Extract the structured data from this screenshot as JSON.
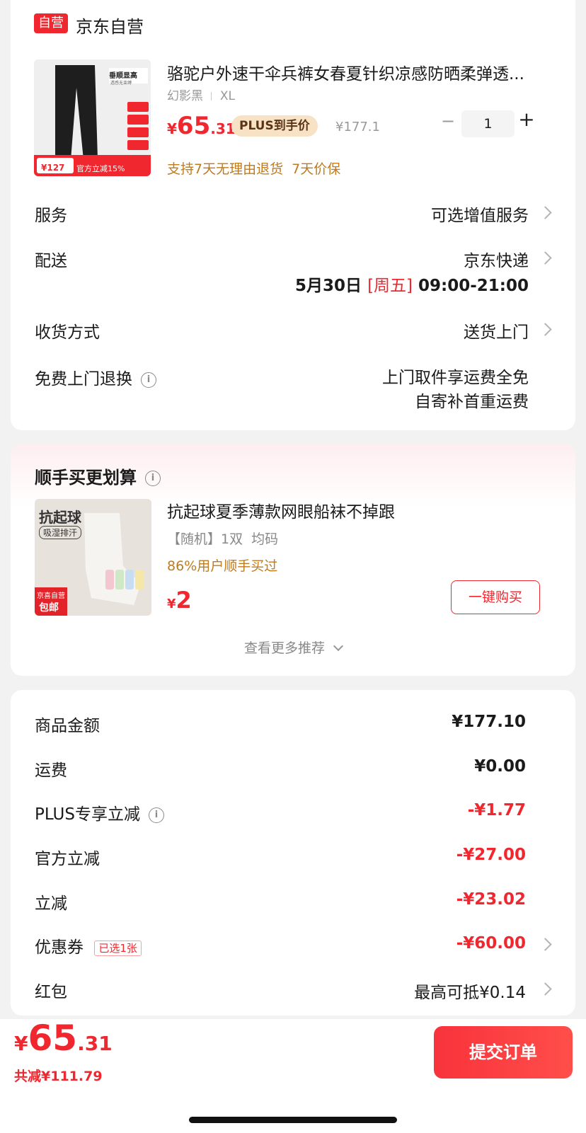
{
  "store": {
    "badge": "自营",
    "name": "京东自营"
  },
  "product": {
    "title": "骆驼户外速干伞兵裤女春夏针织凉感防晒柔弹透...",
    "spec_color": "幻影黑",
    "spec_size": "XL",
    "price_symbol": "¥",
    "price_int": "65",
    "price_dec": ".31",
    "plus_tag": "PLUS到手价",
    "orig_price": "¥177.1",
    "quantity": "1",
    "minus": "−",
    "plus": "+",
    "service_tags": "支持7天无理由退货  7天价保",
    "thumb_heading": "垂顺显高",
    "thumb_subheading": "透感无束缚",
    "thumb_price_label": "¥127",
    "thumb_promo": "官方立减15%"
  },
  "rows": {
    "service_label": "服务",
    "service_value": "可选增值服务",
    "delivery_label": "配送",
    "delivery_value": "京东快递",
    "delivery_date": "5月30日",
    "delivery_weekday": "[周五]",
    "delivery_time": "09:00-21:00",
    "receive_label": "收货方式",
    "receive_value": "送货上门",
    "return_label": "免费上门退换",
    "return_value_1": "上门取件享运费全免",
    "return_value_2": "自寄补首重运费"
  },
  "recommend": {
    "title": "顺手买更划算",
    "item_title": "抗起球夏季薄款网眼船袜不掉跟",
    "item_spec": "【随机】1双  均码",
    "item_social": "86%用户顺手买过",
    "item_price_symbol": "¥",
    "item_price": "2",
    "buy_button": "一键购买",
    "more": "查看更多推荐",
    "thumb_heading": "抗起球",
    "thumb_tag": "吸湿排汗",
    "thumb_badge_1": "京喜自营",
    "thumb_badge_2": "包邮"
  },
  "summary": {
    "goods_label": "商品金额",
    "goods_value": "¥177.10",
    "ship_label": "运费",
    "ship_value": "¥0.00",
    "plus_label": "PLUS专享立减",
    "plus_value": "-¥1.77",
    "official_label": "官方立减",
    "official_value": "-¥27.00",
    "discount_label": "立减",
    "discount_value": "-¥23.02",
    "coupon_label": "优惠券",
    "coupon_tag": "已选1张",
    "coupon_value": "-¥60.00",
    "redpacket_label": "红包",
    "redpacket_value": "最高可抵¥0.14"
  },
  "footer": {
    "total_symbol": "¥",
    "total_int": "65",
    "total_dec": ".31",
    "saved": "共减¥111.79",
    "submit": "提交订单"
  },
  "colors": {
    "accent": "#f0272f",
    "orange": "#c07a1e",
    "plus_tag_bg": "#f7e2c6"
  }
}
